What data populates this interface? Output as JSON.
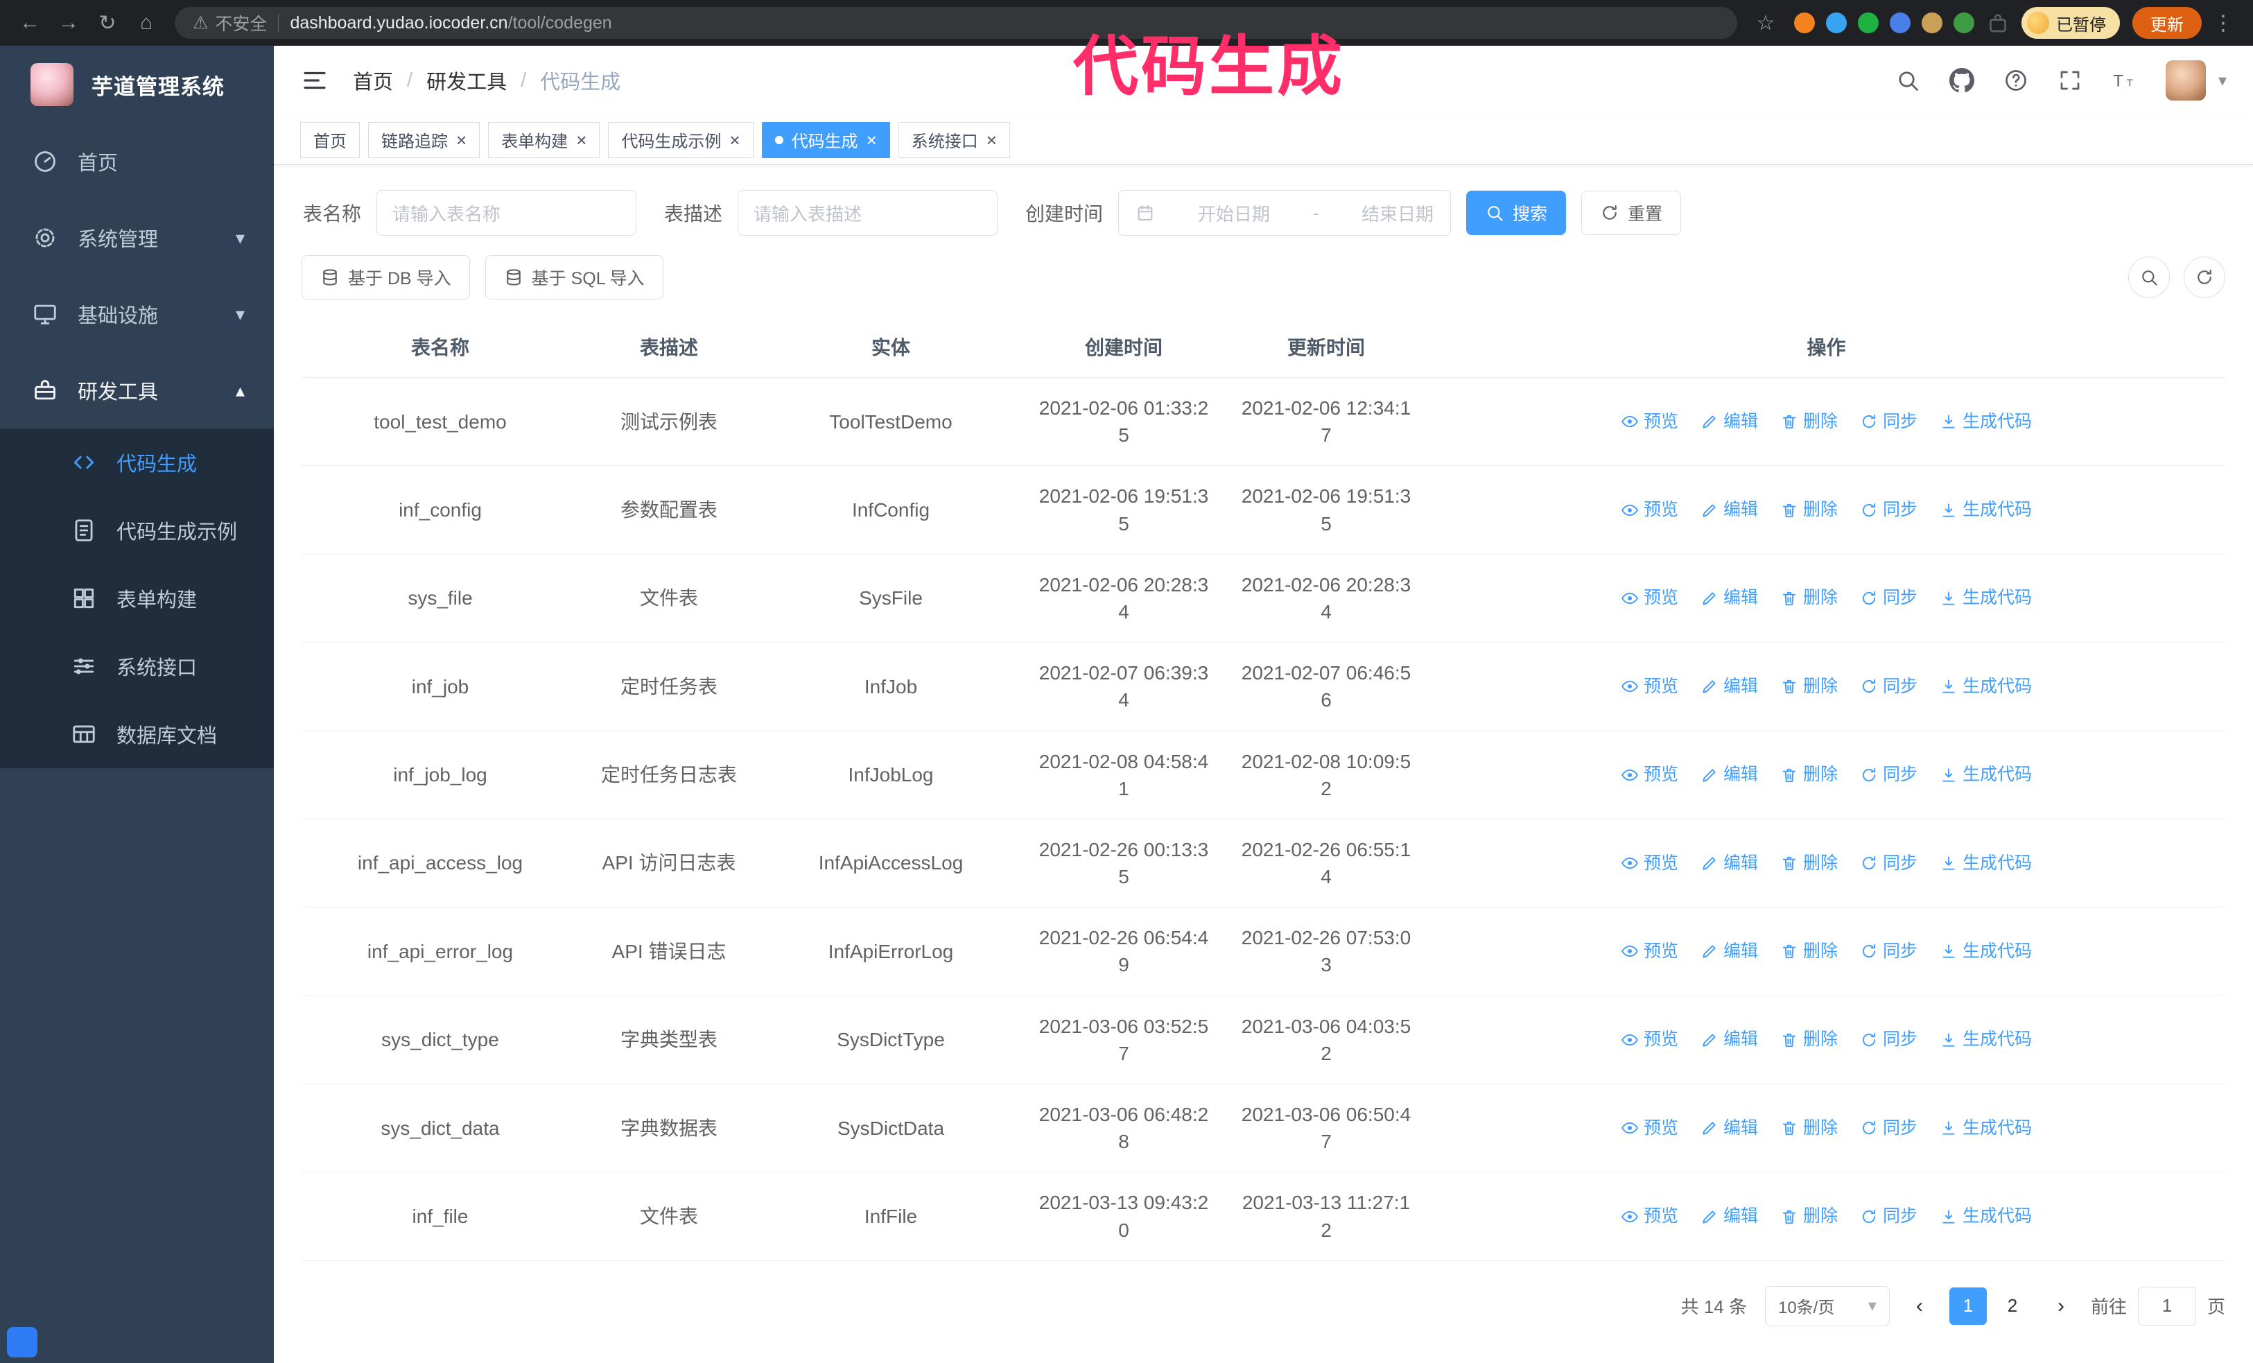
{
  "icons": {
    "back": "←",
    "forward": "→",
    "reload": "↻",
    "home": "⌂",
    "warning": "⚠",
    "star": "☆",
    "kebab": "⋮",
    "caret_down": "▾",
    "caret_up": "▴",
    "prev": "‹",
    "next": "›",
    "close": "×"
  },
  "colors": {
    "accent": "#409eff",
    "sidebar_bg": "#304156",
    "submenu_bg": "#1f2d3d",
    "annotation": "#ff2e68",
    "update_button": "#dd5f12"
  },
  "annotation": {
    "text": "代码生成"
  },
  "browser": {
    "security_label": "不安全",
    "url_host": "dashboard.yudao.iocoder.cn",
    "url_path": "/tool/codegen",
    "profile_badge": "已暂停",
    "update_button": "更新",
    "extensions": [
      {
        "name": "fox-extension-icon",
        "color": "#f4831f"
      },
      {
        "name": "drop-extension-icon",
        "color": "#38a3f1"
      },
      {
        "name": "check-extension-icon",
        "color": "#1fb141"
      },
      {
        "name": "people-extension-icon",
        "color": "#4a7fe8"
      },
      {
        "name": "card-extension-icon",
        "color": "#c9a055"
      },
      {
        "name": "leaf-extension-icon",
        "color": "#3f9b43"
      }
    ]
  },
  "sidebar": {
    "logo_title": "芋道管理系统",
    "items": [
      {
        "id": "home",
        "label": "首页",
        "icon": "dashboard-icon"
      },
      {
        "id": "system",
        "label": "系统管理",
        "icon": "gear-icon",
        "chevron": "down"
      },
      {
        "id": "infra",
        "label": "基础设施",
        "icon": "monitor-icon",
        "chevron": "down"
      },
      {
        "id": "dev-tools",
        "label": "研发工具",
        "icon": "toolbox-icon",
        "chevron": "up",
        "open": true,
        "children": [
          {
            "id": "codegen",
            "label": "代码生成",
            "icon": "code-icon",
            "active": true
          },
          {
            "id": "codegen-example",
            "label": "代码生成示例",
            "icon": "document-icon"
          },
          {
            "id": "form-builder",
            "label": "表单构建",
            "icon": "form-icon"
          },
          {
            "id": "system-api",
            "label": "系统接口",
            "icon": "sliders-icon"
          },
          {
            "id": "db-doc",
            "label": "数据库文档",
            "icon": "grid-icon"
          }
        ]
      }
    ]
  },
  "navbar": {
    "breadcrumb": [
      "首页",
      "研发工具",
      "代码生成"
    ],
    "separator": "/"
  },
  "tabs": [
    {
      "label": "首页",
      "closable": false,
      "active": false
    },
    {
      "label": "链路追踪",
      "closable": true,
      "active": false
    },
    {
      "label": "表单构建",
      "closable": true,
      "active": false
    },
    {
      "label": "代码生成示例",
      "closable": true,
      "active": false
    },
    {
      "label": "代码生成",
      "closable": true,
      "active": true
    },
    {
      "label": "系统接口",
      "closable": true,
      "active": false
    }
  ],
  "filters": {
    "table_name_label": "表名称",
    "table_name_placeholder": "请输入表名称",
    "table_desc_label": "表描述",
    "table_desc_placeholder": "请输入表描述",
    "create_time_label": "创建时间",
    "date_start_placeholder": "开始日期",
    "date_separator": "-",
    "date_end_placeholder": "结束日期",
    "search_button": "搜索",
    "reset_button": "重置"
  },
  "toolbar": {
    "import_db": "基于 DB 导入",
    "import_sql": "基于 SQL 导入"
  },
  "table": {
    "columns": [
      "表名称",
      "表描述",
      "实体",
      "创建时间",
      "更新时间",
      "操作"
    ],
    "actions": [
      {
        "id": "preview",
        "label": "预览"
      },
      {
        "id": "edit",
        "label": "编辑"
      },
      {
        "id": "delete",
        "label": "删除"
      },
      {
        "id": "sync",
        "label": "同步"
      },
      {
        "id": "generate",
        "label": "生成代码"
      }
    ],
    "rows": [
      {
        "name": "tool_test_demo",
        "desc": "测试示例表",
        "entity": "ToolTestDemo",
        "created": "2021-02-06 01:33:25",
        "updated": "2021-02-06 12:34:17"
      },
      {
        "name": "inf_config",
        "desc": "参数配置表",
        "entity": "InfConfig",
        "created": "2021-02-06 19:51:35",
        "updated": "2021-02-06 19:51:35"
      },
      {
        "name": "sys_file",
        "desc": "文件表",
        "entity": "SysFile",
        "created": "2021-02-06 20:28:34",
        "updated": "2021-02-06 20:28:34"
      },
      {
        "name": "inf_job",
        "desc": "定时任务表",
        "entity": "InfJob",
        "created": "2021-02-07 06:39:34",
        "updated": "2021-02-07 06:46:56"
      },
      {
        "name": "inf_job_log",
        "desc": "定时任务日志表",
        "entity": "InfJobLog",
        "created": "2021-02-08 04:58:41",
        "updated": "2021-02-08 10:09:52"
      },
      {
        "name": "inf_api_access_log",
        "desc": "API 访问日志表",
        "entity": "InfApiAccessLog",
        "created": "2021-02-26 00:13:35",
        "updated": "2021-02-26 06:55:14"
      },
      {
        "name": "inf_api_error_log",
        "desc": "API 错误日志",
        "entity": "InfApiErrorLog",
        "created": "2021-02-26 06:54:49",
        "updated": "2021-02-26 07:53:03"
      },
      {
        "name": "sys_dict_type",
        "desc": "字典类型表",
        "entity": "SysDictType",
        "created": "2021-03-06 03:52:57",
        "updated": "2021-03-06 04:03:52"
      },
      {
        "name": "sys_dict_data",
        "desc": "字典数据表",
        "entity": "SysDictData",
        "created": "2021-03-06 06:48:28",
        "updated": "2021-03-06 06:50:47"
      },
      {
        "name": "inf_file",
        "desc": "文件表",
        "entity": "InfFile",
        "created": "2021-03-13 09:43:20",
        "updated": "2021-03-13 11:27:12"
      }
    ]
  },
  "pagination": {
    "total": "共 14 条",
    "page_size": "10条/页",
    "pages": [
      "1",
      "2"
    ],
    "active_page": "1",
    "goto_label": "前往",
    "goto_value": "1",
    "goto_suffix": "页"
  }
}
